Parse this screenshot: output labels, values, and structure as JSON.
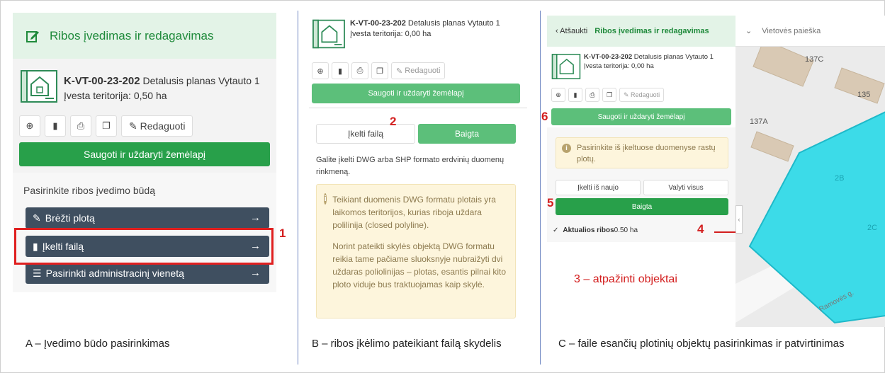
{
  "panelA": {
    "title": "Ribos įvedimas ir redagavimas",
    "doc_code": "K-VT-00-23-202",
    "doc_name": " Detalusis planas Vytauto 1",
    "territory": "Įvesta teritorija: 0,50 ha",
    "edit_label": "Redaguoti",
    "save_close_label": "Saugoti ir uždaryti žemėlapį",
    "choose_label": "Pasirinkite ribos įvedimo būdą",
    "options": [
      {
        "label": "Brėžti plotą",
        "icon": "edit-icon"
      },
      {
        "label": "Įkelti failą",
        "icon": "file-icon"
      },
      {
        "label": "Pasirinkti administracinį vienetą",
        "icon": "list-icon"
      }
    ],
    "marker": "1",
    "arrow": "→"
  },
  "panelB": {
    "doc_code": "K-VT-00-23-202",
    "doc_name": " Detalusis planas Vytauto 1",
    "territory": "Įvesta teritorija: 0,00 ha",
    "edit_label": "Redaguoti",
    "save_close_label": "Saugoti ir uždaryti žemėlapį",
    "upload_tab": "Įkelti failą",
    "done_tab": "Baigta",
    "marker": "2",
    "hint": "Galite įkelti DWG arba SHP formato erdvinių duomenų rinkmeną.",
    "note_p1": "Teikiant duomenis DWG formatu plotais yra laikomos teritorijos, kurias riboja uždara polilinija (closed polyline).",
    "note_p2": "Norint pateikti skylės objektą DWG formatu reikia tame pačiame sluoksnyje nubraižyti dvi uždaras poliolinijas – plotas, esantis pilnai kito ploto viduje bus traktuojamas kaip skylė."
  },
  "panelC": {
    "back": "Atšaukti",
    "title": "Ribos įvedimas ir redagavimas",
    "search_placeholder": "Vietovės paieška",
    "doc_code": "K-VT-00-23-202",
    "doc_name": " Detalusis planas Vytauto 1",
    "territory": "Įvesta teritorija: 0,00 ha",
    "edit_label": "Redaguoti",
    "save_close_label": "Saugoti ir uždaryti žemėlapį",
    "note": "Pasirinkite iš įkeltuose duomenyse rastų plotų.",
    "reupload": "Įkelti iš naujo",
    "clear_all": "Valyti visus",
    "done": "Baigta",
    "layer_name": "Aktualios ribos",
    "layer_area": " 0.50 ha",
    "markers": {
      "m3": "3 – atpažinti objektai",
      "m4": "4",
      "m5": "5",
      "m6": "6"
    },
    "map_labels": [
      "137C",
      "135",
      "137A",
      "2B",
      "2C",
      "Ramovės g."
    ]
  },
  "captions": {
    "a": "A – Įvedimo būdo pasirinkimas",
    "b": "B – ribos įkėlimo pateikiant failą skydelis",
    "c": "C – faile esančių plotinių objektų pasirinkimas ir patvirtinimas"
  },
  "colors": {
    "green": "#28a04a",
    "dark_nav": "#3f4f60",
    "highlight_red": "#d31e1e",
    "parcel_cyan": "#3cdbe8"
  }
}
